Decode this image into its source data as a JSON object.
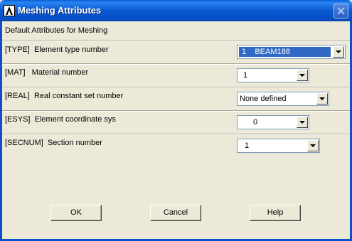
{
  "window": {
    "title": "Meshing Attributes",
    "header": "Default Attributes for Meshing"
  },
  "rows": [
    {
      "label": "[TYPE]  Element type number",
      "value": "1    BEAM188"
    },
    {
      "label": "[MAT]   Material number",
      "value": "1"
    },
    {
      "label": "[REAL]  Real constant set number",
      "value": "None defined"
    },
    {
      "label": "[ESYS]  Element coordinate sys",
      "value": "0"
    },
    {
      "label": "[SECNUM]  Section number",
      "value": "1"
    }
  ],
  "buttons": {
    "ok": "OK",
    "cancel": "Cancel",
    "help": "Help"
  },
  "icons": {
    "app": "ansys-logo-icon",
    "close": "close-icon",
    "dropdown": "chevron-down-icon"
  },
  "colors": {
    "titlebar": "#0a58d0",
    "face": "#ece9d8",
    "selection": "#316ac5"
  }
}
